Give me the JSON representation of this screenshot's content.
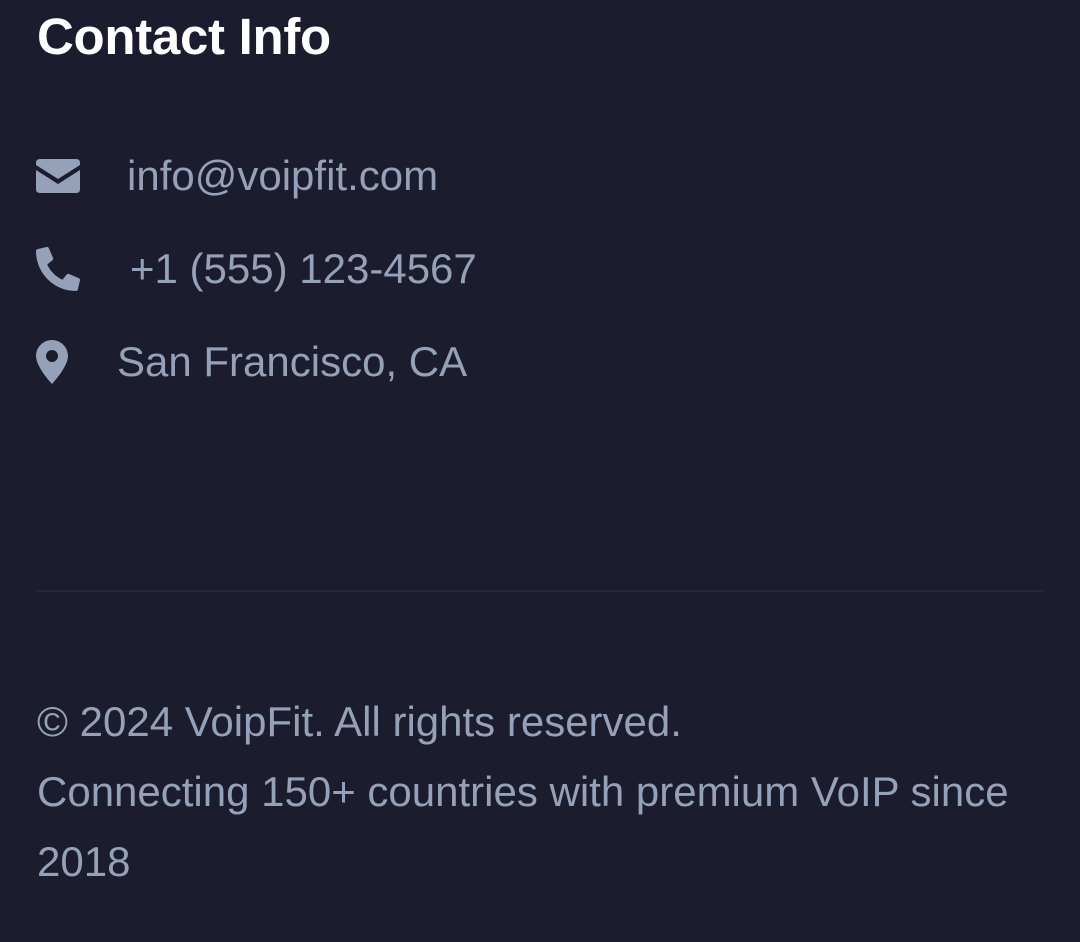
{
  "contact": {
    "title": "Contact Info",
    "email": {
      "icon": "envelope-icon",
      "text": "info@voipfit.com"
    },
    "phone": {
      "icon": "phone-icon",
      "text": "+1 (555) 123-4567"
    },
    "location": {
      "icon": "map-marker-icon",
      "text": "San Francisco, CA"
    }
  },
  "footer": {
    "copyright": "© 2024 VoipFit. All rights reserved.",
    "tagline": "Connecting 150+ countries with premium VoIP since 2018"
  },
  "colors": {
    "background": "#1b1c2e",
    "heading": "#ffffff",
    "muted_text": "#94a1b8",
    "divider": "#25273b"
  }
}
